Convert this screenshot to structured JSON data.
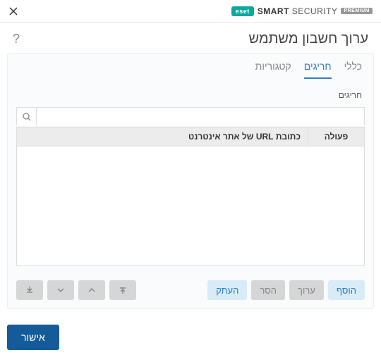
{
  "brand": {
    "badge": "eset",
    "smart": "SMART",
    "security": "SECURITY",
    "premium": "PREMIUM"
  },
  "header": {
    "title": "ערוך חשבון משתמש"
  },
  "tabs": {
    "general": "כללי",
    "exceptions": "חריגים",
    "categories": "קטגוריות"
  },
  "section": {
    "label": "חריגים"
  },
  "table": {
    "action": "פעולה",
    "url": "כתובת URL של אתר אינטרנט"
  },
  "buttons": {
    "add": "הוסף",
    "edit": "ערוך",
    "remove": "הסר",
    "copy": "העתק",
    "ok": "אישור"
  },
  "search": {
    "placeholder": ""
  }
}
